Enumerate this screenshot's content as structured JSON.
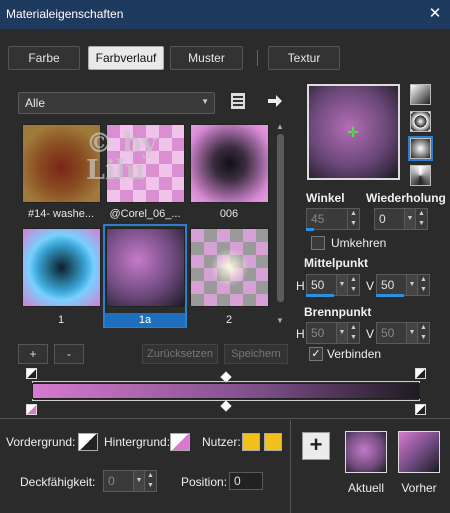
{
  "window": {
    "title": "Materialeigenschaften",
    "close": "✕"
  },
  "tabs": [
    "Farbe",
    "Farbverlauf",
    "Muster",
    "Textur"
  ],
  "dropdown": {
    "value": "Alle"
  },
  "thumbs": [
    {
      "label": "#14- washe..."
    },
    {
      "label": "@Corel_06_..."
    },
    {
      "label": "006"
    },
    {
      "label": "1"
    },
    {
      "label": "1a"
    },
    {
      "label": "2"
    }
  ],
  "watermark": "© by Lilu",
  "buttons": {
    "plus": "+",
    "minus": "-",
    "reset": "Zurücksetzen",
    "save": "Speichern",
    "add": "+"
  },
  "angle": {
    "label": "Winkel",
    "value": "45",
    "repeat_label": "Wiederholung",
    "repeat_value": "0"
  },
  "invert": {
    "label": "Umkehren",
    "checked": false
  },
  "center": {
    "label": "Mittelpunkt",
    "h": "50",
    "v": "50",
    "h_prefix": "H",
    "v_prefix": "V"
  },
  "focal": {
    "label": "Brennpunkt",
    "h": "50",
    "v": "50",
    "h_prefix": "H",
    "v_prefix": "V"
  },
  "link": {
    "label": "Verbinden",
    "checked": true
  },
  "bottom": {
    "fg_label": "Vordergrund:",
    "bg_label": "Hintergrund:",
    "user_label": "Nutzer:",
    "opacity_label": "Deckfähigkeit:",
    "opacity_value": "0",
    "position_label": "Position:",
    "position_value": "0",
    "current_label": "Aktuell",
    "prev_label": "Vorher"
  },
  "colors": {
    "accent": "#2c7fd0",
    "pink": "#d77ad0",
    "purple": "#7b4d86",
    "user": "#f2c01b"
  },
  "icons": [
    "close-icon",
    "book-icon",
    "arrow-right-icon",
    "spin-up-icon",
    "spin-down-icon",
    "dropdown-arrow-icon"
  ]
}
